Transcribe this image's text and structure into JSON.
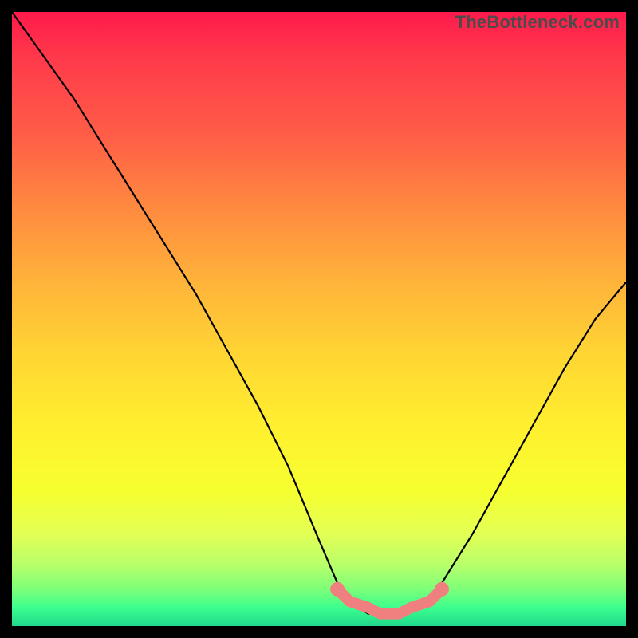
{
  "watermark": "TheBottleneck.com",
  "chart_data": {
    "type": "line",
    "title": "",
    "xlabel": "",
    "ylabel": "",
    "xlim": [
      0,
      100
    ],
    "ylim": [
      0,
      100
    ],
    "series": [
      {
        "name": "bottleneck-curve",
        "x": [
          0,
          5,
          10,
          15,
          20,
          25,
          30,
          35,
          40,
          45,
          50,
          53,
          55,
          58,
          60,
          63,
          65,
          68,
          70,
          75,
          80,
          85,
          90,
          95,
          100
        ],
        "y": [
          100,
          93,
          86,
          78,
          70,
          62,
          54,
          45,
          36,
          26,
          14,
          7,
          4,
          2,
          2,
          2,
          3,
          4,
          7,
          15,
          24,
          33,
          42,
          50,
          56
        ]
      }
    ],
    "highlight_band": {
      "name": "optimal-zone-markers",
      "x": [
        53,
        55,
        58,
        60,
        63,
        65,
        68,
        70
      ],
      "y": [
        6,
        4,
        3,
        2,
        2,
        3,
        4,
        6
      ]
    },
    "colors": {
      "curve": "#000000",
      "marker_fill": "#f08080",
      "marker_stroke": "#d95c5c",
      "background_top": "#ff1a4b",
      "background_bottom": "#1fd98c",
      "frame": "#000000"
    }
  }
}
